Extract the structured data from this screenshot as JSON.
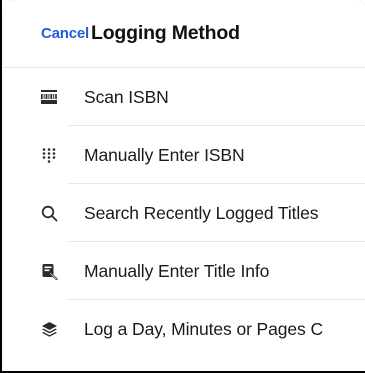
{
  "header": {
    "cancel_label": "Cancel",
    "title": "Logging Method"
  },
  "colors": {
    "accent": "#1f5fd8",
    "text": "#1a1a1a",
    "icon": "#2b2b2b",
    "divider": "#e6e6e6"
  },
  "options": [
    {
      "label": "Scan ISBN",
      "icon": "barcode-icon"
    },
    {
      "label": "Manually Enter ISBN",
      "icon": "keypad-icon"
    },
    {
      "label": "Search Recently Logged Titles",
      "icon": "search-icon"
    },
    {
      "label": "Manually Enter Title Info",
      "icon": "book-edit-icon"
    },
    {
      "label": "Log a Day, Minutes or Pages C",
      "icon": "stack-layers-icon"
    }
  ]
}
